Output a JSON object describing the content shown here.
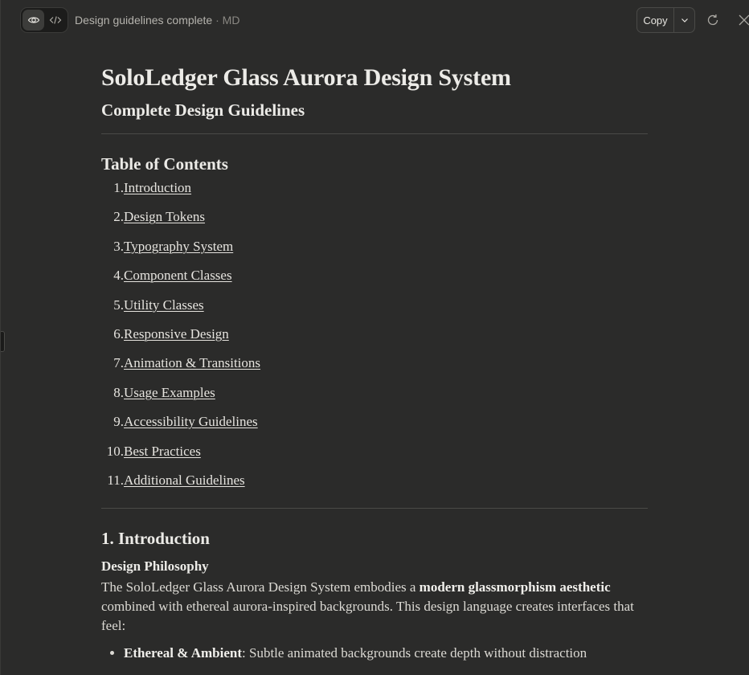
{
  "header": {
    "preview_icon": "eye-icon",
    "code_icon": "code-icon",
    "doc_name": "Design guidelines complete",
    "separator": "·",
    "doc_format": "MD",
    "copy_label": "Copy",
    "dropdown_icon": "chevron-down-icon",
    "refresh_icon": "refresh-icon",
    "close_icon": "close-icon"
  },
  "document": {
    "title": "SoloLedger Glass Aurora Design System",
    "subtitle": "Complete Design Guidelines",
    "toc_heading": "Table of Contents",
    "toc": [
      {
        "num": "1.",
        "label": "Introduction"
      },
      {
        "num": "2.",
        "label": "Design Tokens"
      },
      {
        "num": "3.",
        "label": "Typography System"
      },
      {
        "num": "4.",
        "label": "Component Classes"
      },
      {
        "num": "5.",
        "label": "Utility Classes"
      },
      {
        "num": "6.",
        "label": "Responsive Design"
      },
      {
        "num": "7.",
        "label": "Animation & Transitions"
      },
      {
        "num": "8.",
        "label": "Usage Examples"
      },
      {
        "num": "9.",
        "label": "Accessibility Guidelines"
      },
      {
        "num": "10.",
        "label": "Best Practices"
      },
      {
        "num": "11.",
        "label": "Additional Guidelines"
      }
    ],
    "intro_heading": "1. Introduction",
    "philosophy_heading": "Design Philosophy",
    "philosophy_text_before": "The SoloLedger Glass Aurora Design System embodies a ",
    "philosophy_text_bold": "modern glassmorphism aesthetic",
    "philosophy_text_after": " combined with ethereal aurora-inspired backgrounds. This design language creates interfaces that feel:",
    "bullets": [
      {
        "bold": "Ethereal & Ambient",
        "text": ": Subtle animated backgrounds create depth without distraction"
      }
    ]
  },
  "colors": {
    "background": "#2b2b2a",
    "text": "#e6e4df",
    "muted": "#b5b3ad"
  }
}
